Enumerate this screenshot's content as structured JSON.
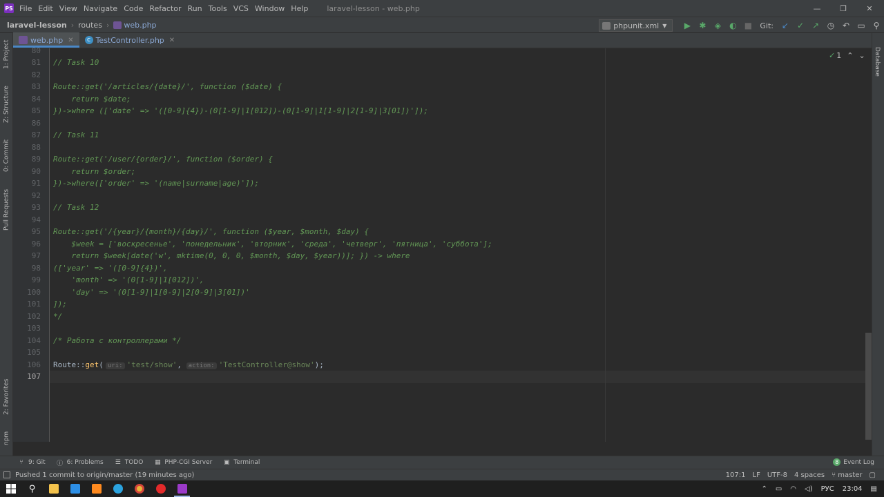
{
  "menubar": {
    "items": [
      "File",
      "Edit",
      "View",
      "Navigate",
      "Code",
      "Refactor",
      "Run",
      "Tools",
      "VCS",
      "Window",
      "Help"
    ],
    "window_title": "laravel-lesson - web.php"
  },
  "navbar": {
    "project": "laravel-lesson",
    "folder": "routes",
    "file": "web.php",
    "run_config": "phpunit.xml",
    "git_label": "Git:"
  },
  "tabs": [
    {
      "label": "web.php",
      "active": true
    },
    {
      "label": "TestController.php",
      "active": false
    }
  ],
  "left_stripe": [
    "1: Project",
    "Z: Structure",
    "0: Commit",
    "Pull Requests",
    "2: Favorites",
    "npm"
  ],
  "right_stripe": [
    "Database"
  ],
  "inspection": {
    "count": "1"
  },
  "lines": [
    {
      "n": "80",
      "t": ""
    },
    {
      "n": "81",
      "t": "// Task 10"
    },
    {
      "n": "82",
      "t": ""
    },
    {
      "n": "83",
      "t": "Route::get('/articles/{date}/', function ($date) {"
    },
    {
      "n": "84",
      "t": "    return $date;"
    },
    {
      "n": "85",
      "t": "})->where (['date' => '([0-9]{4})-(0[1-9]|1[012])-(0[1-9]|1[1-9]|2[1-9]|3[01])']);"
    },
    {
      "n": "86",
      "t": ""
    },
    {
      "n": "87",
      "t": "// Task 11"
    },
    {
      "n": "88",
      "t": ""
    },
    {
      "n": "89",
      "t": "Route::get('/user/{order}/', function ($order) {"
    },
    {
      "n": "90",
      "t": "    return $order;"
    },
    {
      "n": "91",
      "t": "})->where(['order' => '(name|surname|age)']);"
    },
    {
      "n": "92",
      "t": ""
    },
    {
      "n": "93",
      "t": "// Task 12"
    },
    {
      "n": "94",
      "t": ""
    },
    {
      "n": "95",
      "t": "Route::get('/{year}/{month}/{day}/', function ($year, $month, $day) {"
    },
    {
      "n": "96",
      "t": "    $week = ['воскресенье', 'понедельник', 'вторник', 'среда', 'четверг', 'пятница', 'суббота'];"
    },
    {
      "n": "97",
      "t": "    return $week[date('w', mktime(0, 0, 0, $month, $day, $year))]; }) -> where"
    },
    {
      "n": "98",
      "t": "(['year' => '([0-9]{4})',"
    },
    {
      "n": "99",
      "t": "    'month' => '(0[1-9]|1[012])',"
    },
    {
      "n": "100",
      "t": "    'day' => '(0[1-9]|1[0-9]|2[0-9]|3[01])'"
    },
    {
      "n": "101",
      "t": "]);"
    },
    {
      "n": "102",
      "t": "*/"
    },
    {
      "n": "103",
      "t": ""
    },
    {
      "n": "104",
      "t": "/* Работа с контроллерами */"
    },
    {
      "n": "105",
      "t": ""
    },
    {
      "n": "106",
      "t": ""
    },
    {
      "n": "107",
      "t": ""
    }
  ],
  "line106": {
    "route": "Route::",
    "method": "get",
    "paren": "(",
    "hint_uri": "uri:",
    "arg1": "'test/show'",
    "comma": ", ",
    "hint_action": "action:",
    "arg2": "'TestController@show'",
    "end": ");"
  },
  "bottom_tools": [
    {
      "icon": "git-icon",
      "label": "9: Git"
    },
    {
      "icon": "problems-icon",
      "label": "6: Problems"
    },
    {
      "icon": "todo-icon",
      "label": "TODO"
    },
    {
      "icon": "server-icon",
      "label": "PHP-CGI Server"
    },
    {
      "icon": "terminal-icon",
      "label": "Terminal"
    }
  ],
  "event_log": {
    "count": "8",
    "label": "Event Log"
  },
  "status": {
    "message": "Pushed 1 commit to origin/master (19 minutes ago)",
    "position": "107:1",
    "line_sep": "LF",
    "encoding": "UTF-8",
    "indent": "4 spaces",
    "branch": "master"
  },
  "tray": {
    "lang": "РУС",
    "time": "23:04"
  }
}
